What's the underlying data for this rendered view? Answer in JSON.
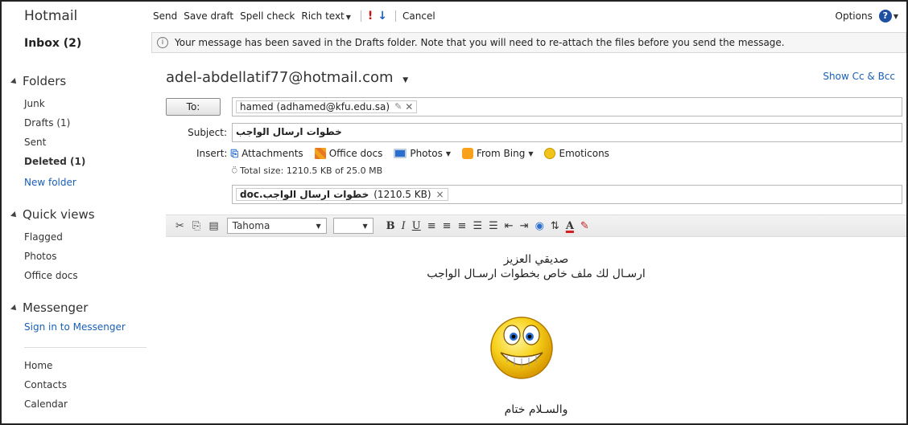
{
  "sidebar": {
    "brand": "Hotmail",
    "inbox": "Inbox (2)",
    "folders_head": "Folders",
    "folders": [
      "Junk",
      "Drafts (1)",
      "Sent",
      "Deleted (1)",
      "New folder"
    ],
    "quick_head": "Quick views",
    "quick": [
      "Flagged",
      "Photos",
      "Office docs"
    ],
    "messenger_head": "Messenger",
    "messenger_link": "Sign in to Messenger",
    "bottom": [
      "Home",
      "Contacts",
      "Calendar"
    ]
  },
  "toolbar": {
    "send": "Send",
    "save_draft": "Save draft",
    "spell_check": "Spell check",
    "rich_text": "Rich text",
    "cancel": "Cancel",
    "options": "Options",
    "help": "?"
  },
  "notice": "Your message has been saved in the Drafts folder. Note that you will need to re-attach the files before you send the message.",
  "from": "adel-abdellatif77@hotmail.com",
  "show_cc": "Show Cc & Bcc",
  "to": {
    "label": "To:",
    "recipient": "hamed  (adhamed@kfu.edu.sa)"
  },
  "subject": {
    "label": "Subject:",
    "value": "خطوات ارسال الواجب"
  },
  "insert": {
    "label": "Insert:",
    "attachments": "Attachments",
    "office_docs": "Office docs",
    "photos": "Photos",
    "from_bing": "From Bing",
    "emoticons": "Emoticons",
    "total": "Total size: 1210.5 KB of 25.0 MB"
  },
  "attachment": {
    "name": "خطوات ارسال الواجب.doc",
    "size": "(1210.5 KB)"
  },
  "format": {
    "font": "Tahoma",
    "size": ""
  },
  "body": {
    "line1": "صديقي العزيز",
    "line2": "ارسـال لك ملف خاص بخطوات ارسـال الواجب",
    "line3": "والسـلام ختام"
  }
}
